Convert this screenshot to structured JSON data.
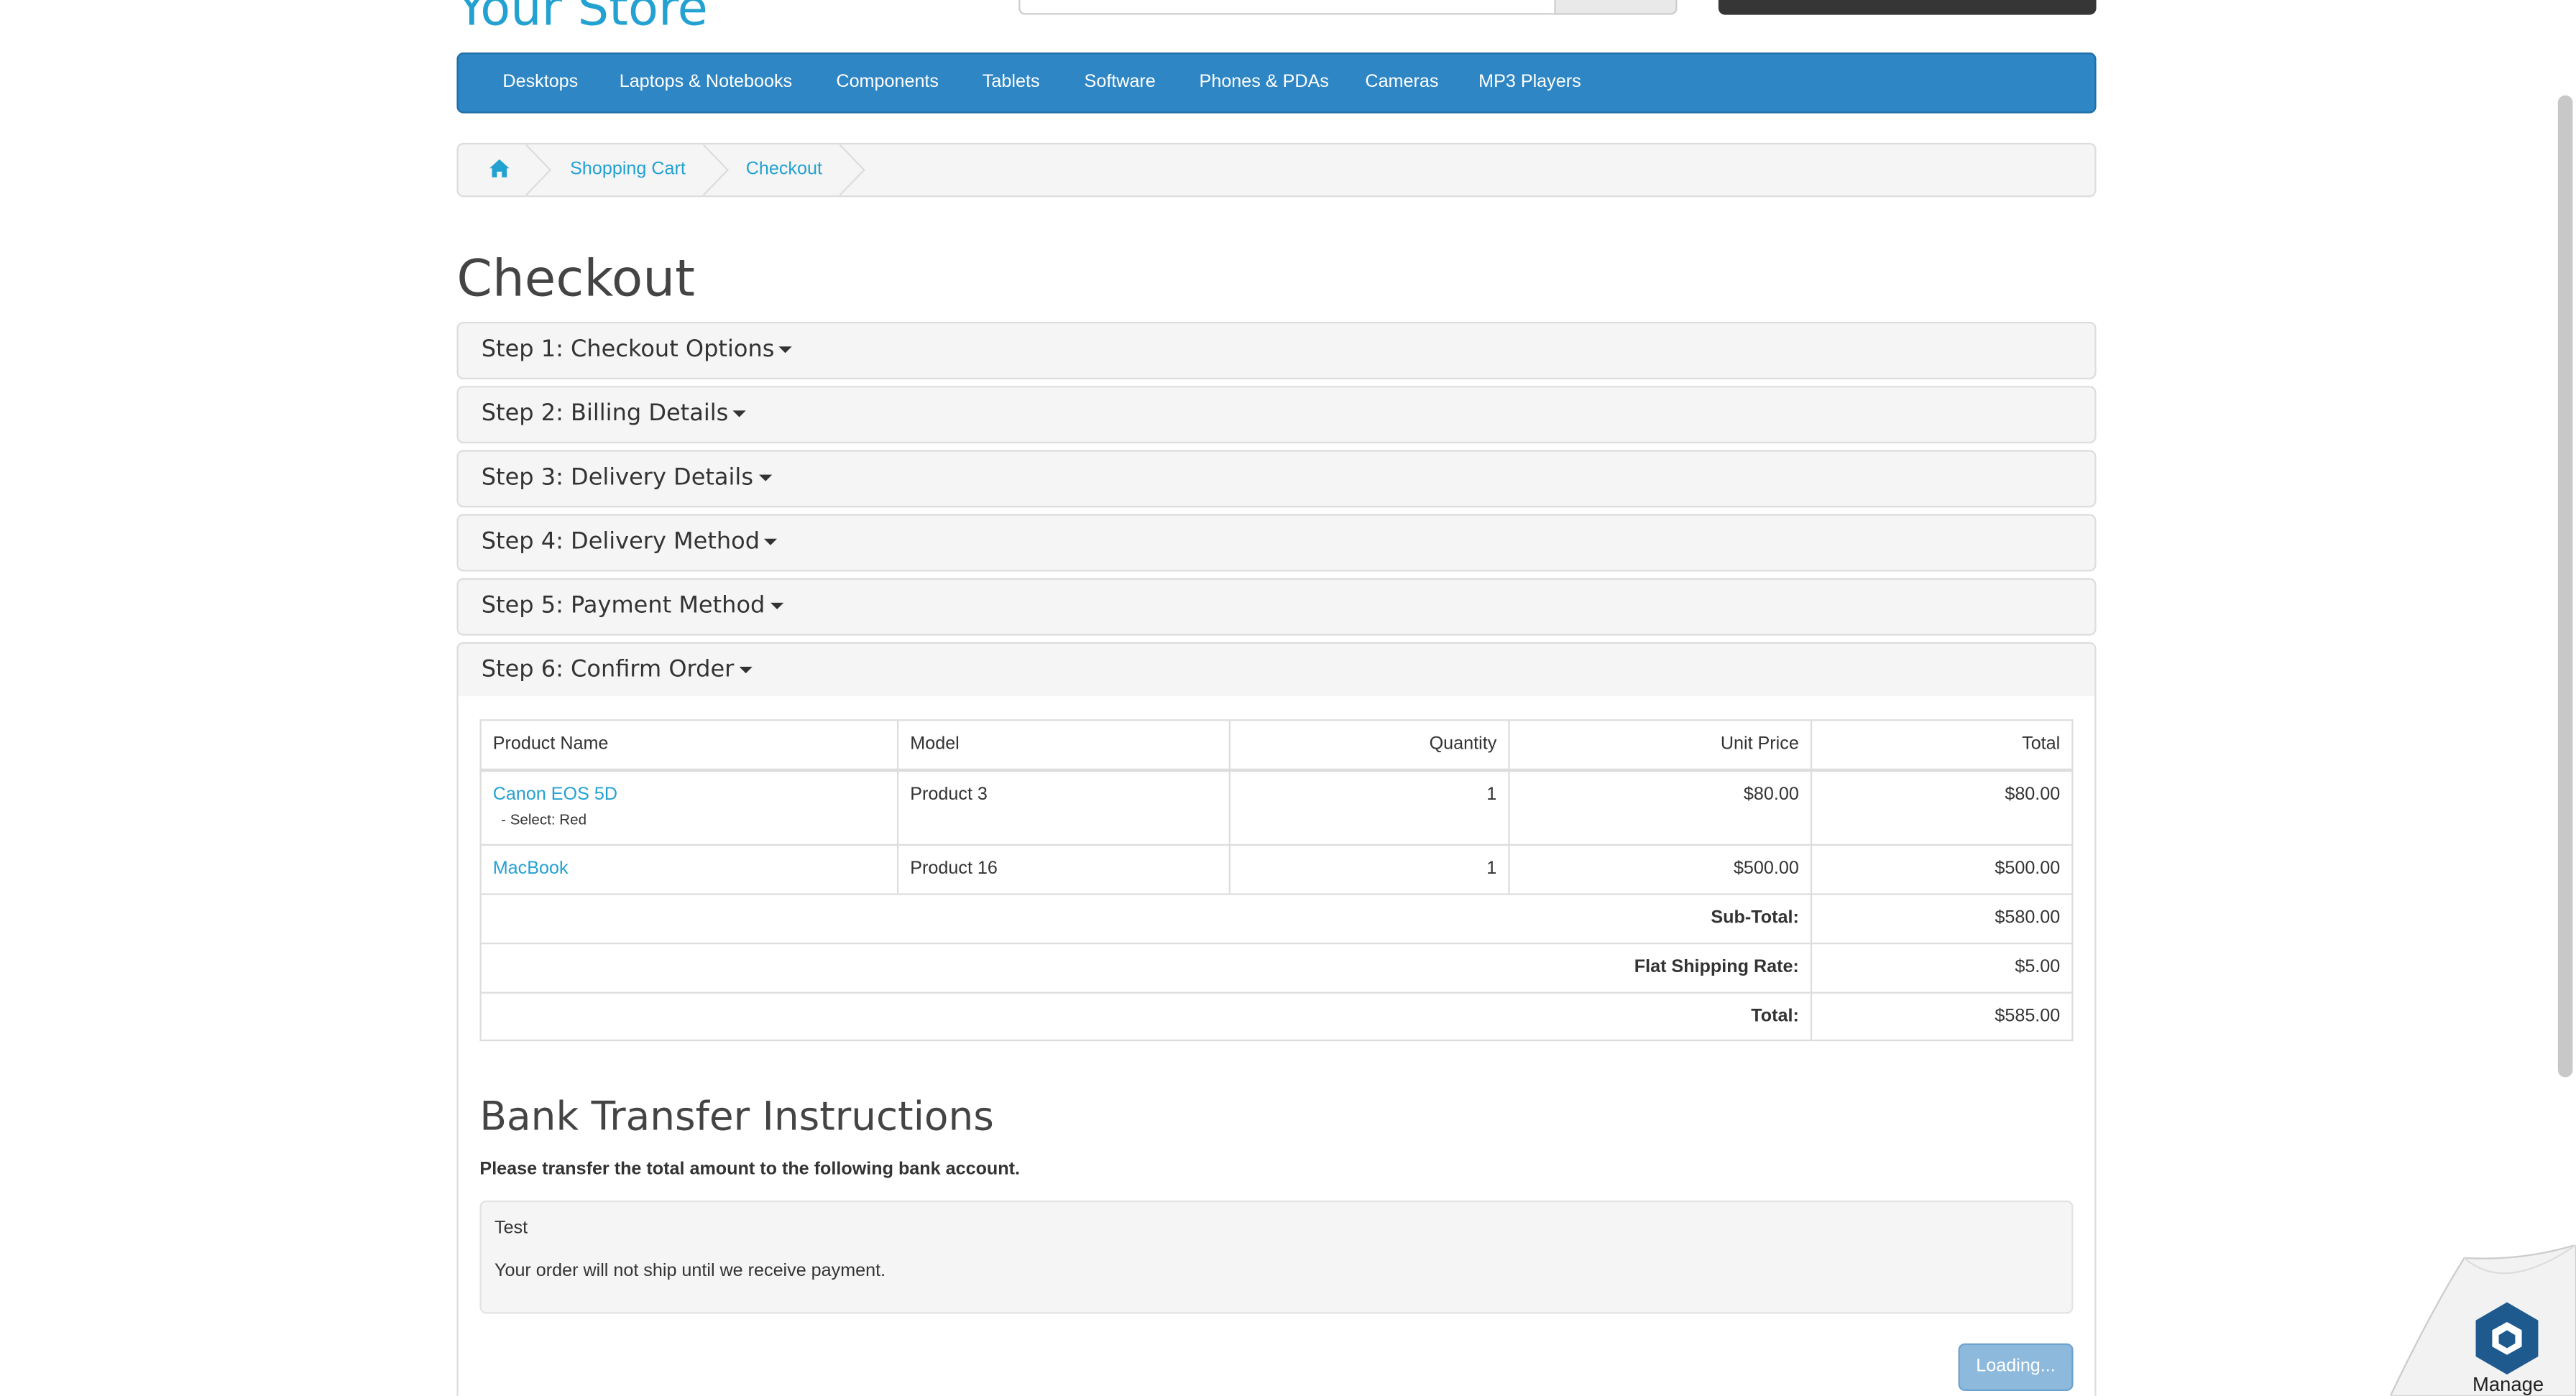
{
  "header": {
    "store_name": "Your Store"
  },
  "menu": {
    "items": [
      "Desktops",
      "Laptops & Notebooks",
      "Components",
      "Tablets",
      "Software",
      "Phones & PDAs",
      "Cameras",
      "MP3 Players"
    ]
  },
  "breadcrumb": {
    "items": [
      "Shopping Cart",
      "Checkout"
    ]
  },
  "page": {
    "title": "Checkout"
  },
  "steps": [
    "Step 1: Checkout Options",
    "Step 2: Billing Details",
    "Step 3: Delivery Details",
    "Step 4: Delivery Method",
    "Step 5: Payment Method",
    "Step 6: Confirm Order"
  ],
  "order_table": {
    "headers": [
      "Product Name",
      "Model",
      "Quantity",
      "Unit Price",
      "Total"
    ],
    "rows": [
      {
        "name": "Canon EOS 5D",
        "option": "- Select: Red",
        "model": "Product 3",
        "quantity": "1",
        "unit_price": "$80.00",
        "total": "$80.00"
      },
      {
        "name": "MacBook",
        "option": "",
        "model": "Product 16",
        "quantity": "1",
        "unit_price": "$500.00",
        "total": "$500.00"
      }
    ],
    "totals": [
      {
        "label": "Sub-Total:",
        "value": "$580.00"
      },
      {
        "label": "Flat Shipping Rate:",
        "value": "$5.00"
      },
      {
        "label": "Total:",
        "value": "$585.00"
      }
    ]
  },
  "bank": {
    "title": "Bank Transfer Instructions",
    "description": "Please transfer the total amount to the following bank account.",
    "details": "Test",
    "notice": "Your order will not ship until we receive payment."
  },
  "confirm_button": "Loading...",
  "widget": {
    "label": "Manage"
  },
  "colors": {
    "accent": "#2e86c5",
    "link": "#23a1d1",
    "button_disabled": "#8db9dc"
  }
}
